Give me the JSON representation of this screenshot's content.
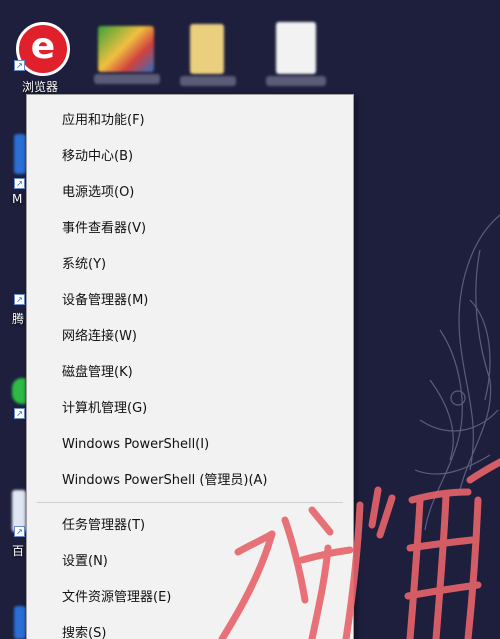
{
  "desktop": {
    "icons": [
      {
        "label": "浏览器",
        "icon": "browser-icon"
      },
      {
        "label": "M",
        "icon": "app-icon"
      },
      {
        "label": "腾",
        "icon": "app-icon"
      },
      {
        "label": "百",
        "icon": "app-icon"
      }
    ],
    "browser_glyph": "e"
  },
  "context_menu": {
    "group1": [
      {
        "label": "应用和功能(F)"
      },
      {
        "label": "移动中心(B)"
      },
      {
        "label": "电源选项(O)"
      },
      {
        "label": "事件查看器(V)"
      },
      {
        "label": "系统(Y)"
      },
      {
        "label": "设备管理器(M)"
      },
      {
        "label": "网络连接(W)"
      },
      {
        "label": "磁盘管理(K)"
      },
      {
        "label": "计算机管理(G)"
      },
      {
        "label": "Windows PowerShell(I)"
      },
      {
        "label": "Windows PowerShell (管理员)(A)"
      }
    ],
    "group2": [
      {
        "label": "任务管理器(T)"
      },
      {
        "label": "设置(N)"
      },
      {
        "label": "文件资源管理器(E)"
      },
      {
        "label": "搜索(S)"
      }
    ]
  },
  "colors": {
    "wallpaper": "#1d1f3d",
    "menu_bg": "#f2f2f2",
    "annotation": "#e8646a"
  }
}
